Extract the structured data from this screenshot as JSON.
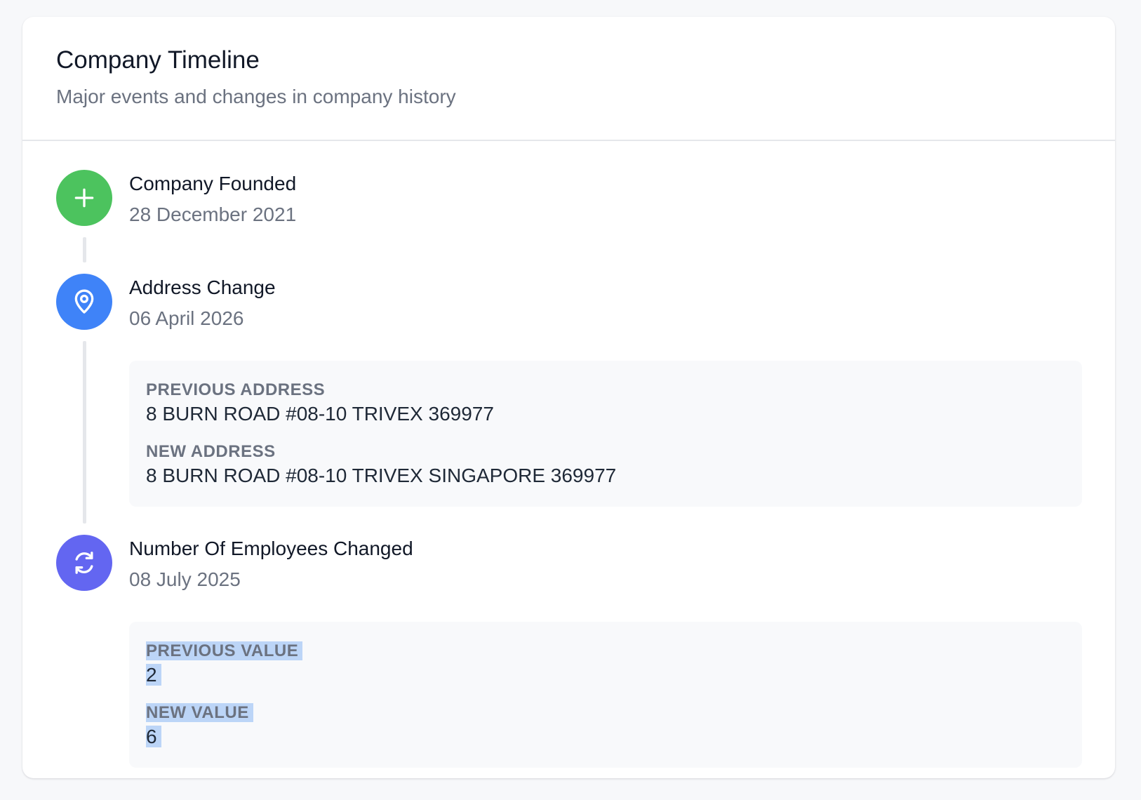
{
  "header": {
    "title": "Company Timeline",
    "subtitle": "Major events and changes in company history"
  },
  "events": [
    {
      "title": "Company Founded",
      "date": "28 December 2021",
      "icon": "plus-icon",
      "color": "#4cc35e"
    },
    {
      "title": "Address Change",
      "date": "06 April 2026",
      "icon": "location-pin-icon",
      "color": "#3f83f8",
      "previous_label": "PREVIOUS ADDRESS",
      "previous_value": "8 BURN ROAD #08-10 TRIVEX 369977",
      "new_label": "NEW ADDRESS",
      "new_value": "8 BURN ROAD #08-10 TRIVEX SINGAPORE 369977"
    },
    {
      "title": "Number Of Employees Changed",
      "date": "08 July 2025",
      "icon": "refresh-icon",
      "color": "#6366f1",
      "previous_label": "PREVIOUS VALUE",
      "previous_value": "2",
      "new_label": "NEW VALUE",
      "new_value": "6"
    }
  ],
  "colors": {
    "page_background": "#f7f8fa",
    "card_background": "#ffffff",
    "selection_highlight": "#bcd5f7"
  }
}
